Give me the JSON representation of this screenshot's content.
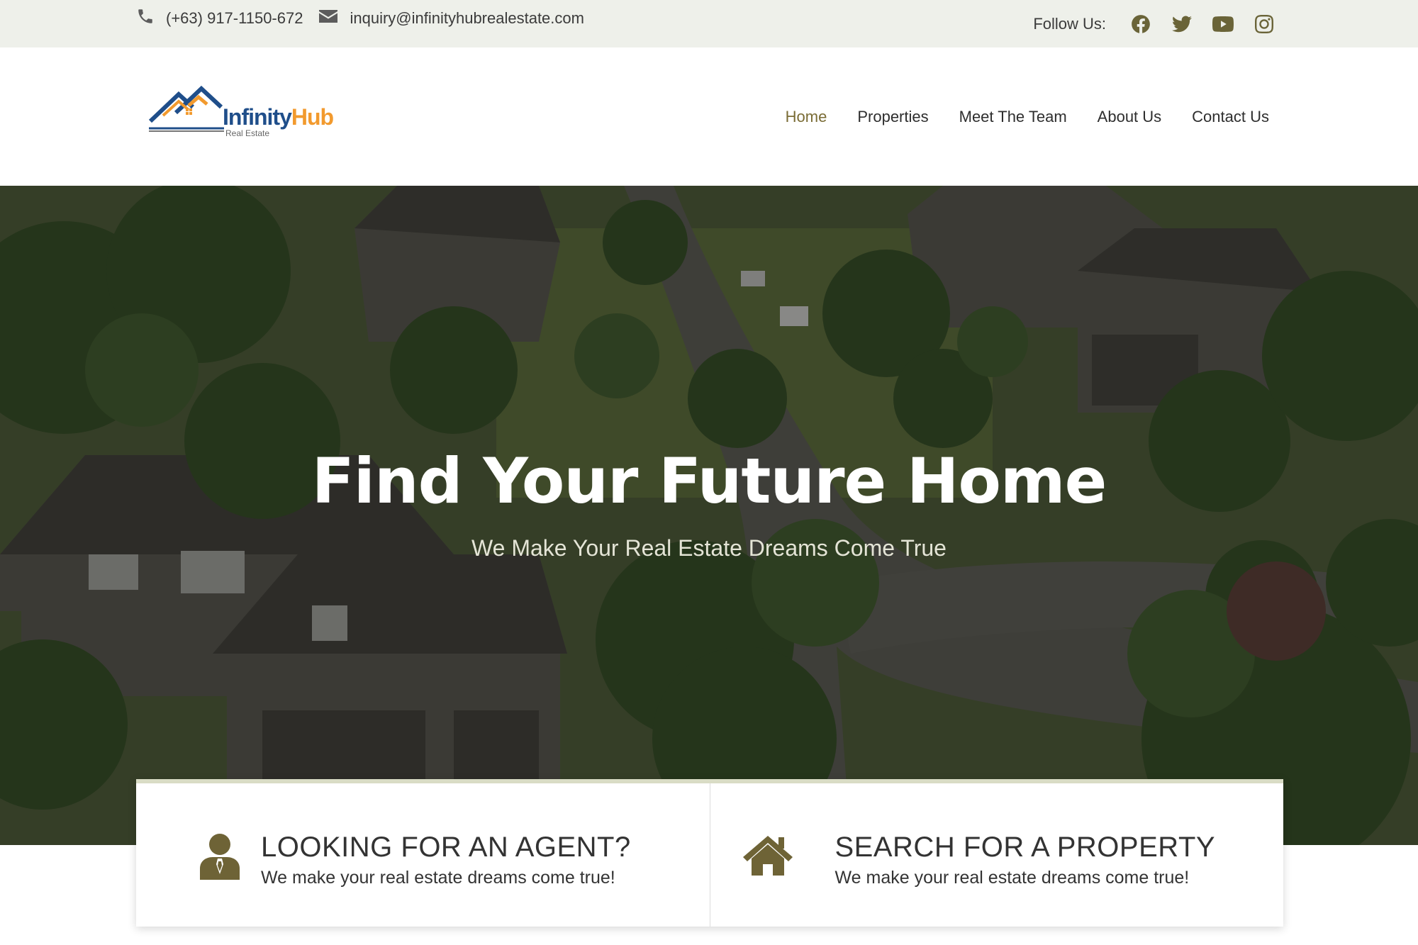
{
  "topbar": {
    "phone": "(+63) 917-1150-672",
    "email": "inquiry@infinityhubrealestate.com",
    "follow_label": "Follow Us:",
    "social": [
      "facebook-icon",
      "twitter-icon",
      "youtube-icon",
      "instagram-icon"
    ]
  },
  "header": {
    "logo": {
      "word1": "Infinity",
      "word2": "Hub",
      "sub": "Real Estate"
    },
    "nav": [
      {
        "label": "Home",
        "active": true
      },
      {
        "label": "Properties"
      },
      {
        "label": "Meet The Team"
      },
      {
        "label": "About Us"
      },
      {
        "label": "Contact Us"
      }
    ]
  },
  "hero": {
    "title": "Find Your Future Home",
    "subtitle": "We Make Your Real Estate Dreams Come True"
  },
  "cards": [
    {
      "icon": "agent-icon",
      "title": "LOOKING FOR AN AGENT?",
      "description": "We make your real estate dreams come true!"
    },
    {
      "icon": "house-icon",
      "title": "SEARCH FOR A PROPERTY",
      "description": "We make your real estate dreams come true!"
    }
  ],
  "colors": {
    "accent": "#7a6c35",
    "topbar_bg": "#eef0ea",
    "icon_olive": "#6e6336",
    "logo_blue": "#1f4e8a",
    "logo_orange": "#f29a2e"
  }
}
